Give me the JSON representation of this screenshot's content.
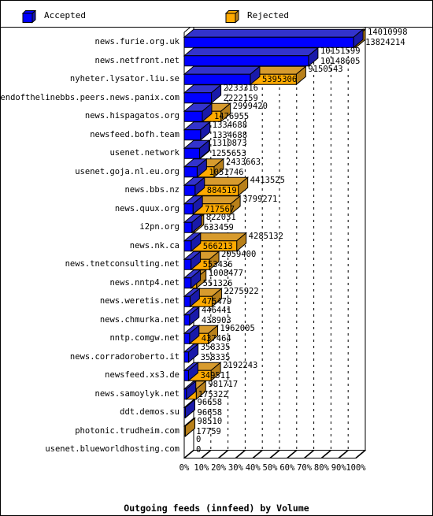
{
  "legend": {
    "items": [
      {
        "label": "Accepted",
        "color": "#0000ff",
        "icon": "cube-icon"
      },
      {
        "label": "Rejected",
        "color": "#ffaa00",
        "icon": "cube-icon"
      }
    ]
  },
  "chart_data": {
    "type": "bar",
    "orientation": "horizontal",
    "stacked": true,
    "title": "",
    "xlabel": "Outgoing feeds (innfeed) by Volume",
    "ylabel": "",
    "xlim": [
      0,
      100
    ],
    "xunit": "%",
    "grid": true,
    "legend_position": "top",
    "xticks": [
      "0%",
      "10%",
      "20%",
      "30%",
      "40%",
      "50%",
      "60%",
      "70%",
      "80%",
      "90%",
      "100%"
    ],
    "xtick_values": [
      0,
      10,
      20,
      30,
      40,
      50,
      60,
      70,
      80,
      90,
      100
    ],
    "categories": [
      "news.furie.org.uk",
      "news.netfront.net",
      "nyheter.lysator.liu.se",
      "endofthelinebbs.peers.news.panix.com",
      "news.hispagatos.org",
      "newsfeed.bofh.team",
      "usenet.network",
      "usenet.goja.nl.eu.org",
      "news.bbs.nz",
      "news.quux.org",
      "i2pn.org",
      "news.nk.ca",
      "news.tnetconsulting.net",
      "news.nntp4.net",
      "news.weretis.net",
      "news.chmurka.net",
      "nntp.comgw.net",
      "news.corradoroberto.it",
      "newsfeed.xs3.de",
      "news.samoylyk.net",
      "ddt.demos.su",
      "photonic.trudheim.com",
      "usenet.blueworldhosting.com"
    ],
    "series": [
      {
        "name": "Accepted",
        "color": "#0000ff",
        "values": [
          13824214,
          10148605,
          5395306,
          2222159,
          1476955,
          1334688,
          1255653,
          1051746,
          884519,
          717567,
          633459,
          566213,
          553436,
          551326,
          475479,
          438903,
          437464,
          358335,
          349511,
          175322,
          96658,
          17759,
          0
        ]
      },
      {
        "name": "Rejected",
        "color": "#ffaa00",
        "values": [
          186784,
          2994,
          3755237,
          11157,
          1522465,
          0,
          55220,
          1381917,
          3529006,
          3081704,
          188572,
          3718919,
          1505964,
          457151,
          1800443,
          7538,
          1524541,
          0,
          1842732,
          806395,
          0,
          80751,
          0
        ]
      }
    ],
    "totals": [
      14010998,
      10151599,
      9150543,
      2233316,
      2999420,
      1334688,
      1310873,
      2433663,
      4413525,
      3799271,
      822031,
      4285132,
      2059400,
      1008477,
      2275922,
      446441,
      1962005,
      358335,
      2192243,
      981717,
      96658,
      98510,
      0
    ],
    "value_labels": [
      {
        "total": "14010998",
        "accepted": "13824214"
      },
      {
        "total": "10151599",
        "accepted": "10148605"
      },
      {
        "total": "9150543",
        "accepted": "5395306"
      },
      {
        "total": "2233316",
        "accepted": "2222159"
      },
      {
        "total": "2999420",
        "accepted": "1476955"
      },
      {
        "total": "1334688",
        "accepted": "1334688"
      },
      {
        "total": "1310873",
        "accepted": "1255653"
      },
      {
        "total": "2433663",
        "accepted": "1051746"
      },
      {
        "total": "4413525",
        "accepted": "884519"
      },
      {
        "total": "3799271",
        "accepted": "717567"
      },
      {
        "total": "822031",
        "accepted": "633459"
      },
      {
        "total": "4285132",
        "accepted": "566213"
      },
      {
        "total": "2059400",
        "accepted": "553436"
      },
      {
        "total": "1008477",
        "accepted": "551326"
      },
      {
        "total": "2275922",
        "accepted": "475479"
      },
      {
        "total": "446441",
        "accepted": "438903"
      },
      {
        "total": "1962005",
        "accepted": "437464"
      },
      {
        "total": "358335",
        "accepted": "358335"
      },
      {
        "total": "2192243",
        "accepted": "349511"
      },
      {
        "total": "981717",
        "accepted": "175322"
      },
      {
        "total": "96658",
        "accepted": "96658"
      },
      {
        "total": "98510",
        "accepted": "17759"
      },
      {
        "total": "0",
        "accepted": "0"
      }
    ]
  }
}
